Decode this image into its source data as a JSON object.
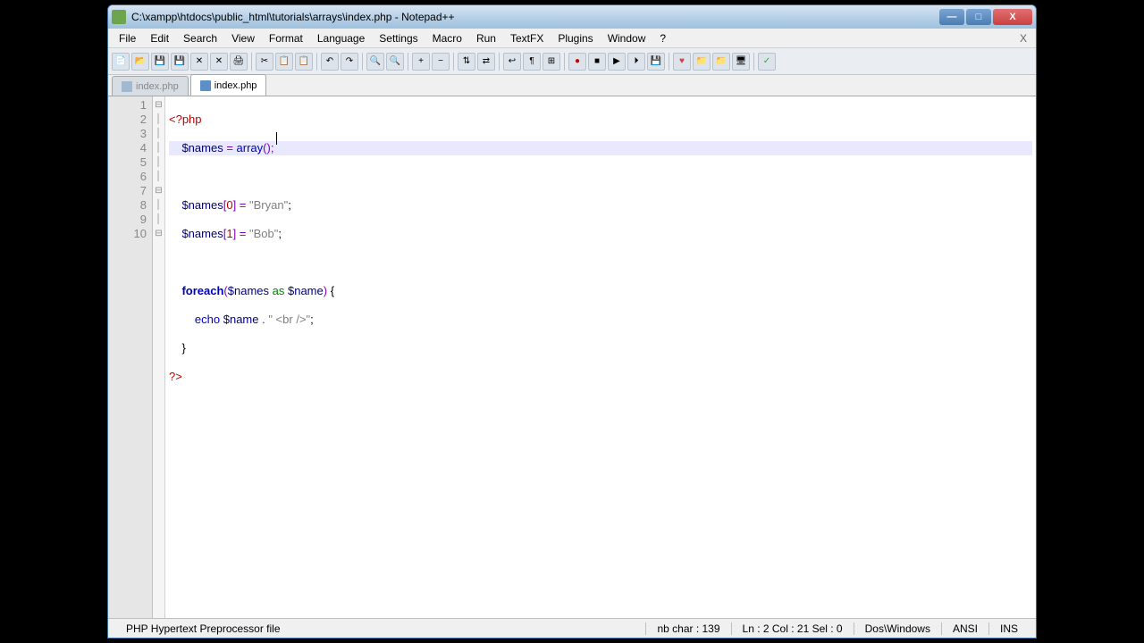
{
  "window": {
    "title": "C:\\xampp\\htdocs\\public_html\\tutorials\\arrays\\index.php - Notepad++"
  },
  "menu": {
    "file": "File",
    "edit": "Edit",
    "search": "Search",
    "view": "View",
    "format": "Format",
    "language": "Language",
    "settings": "Settings",
    "macro": "Macro",
    "run": "Run",
    "textfx": "TextFX",
    "plugins": "Plugins",
    "window": "Window",
    "help": "?",
    "close_x": "X"
  },
  "tabs": {
    "t0": "index.php",
    "t1": "index.php"
  },
  "gutter": {
    "l1": "1",
    "l2": "2",
    "l3": "3",
    "l4": "4",
    "l5": "5",
    "l6": "6",
    "l7": "7",
    "l8": "8",
    "l9": "9",
    "l10": "10"
  },
  "fold": {
    "minus": "⊟",
    "plus": "⊟",
    "bar": "│"
  },
  "code": {
    "l1_open": "<?php",
    "l2_var": "$names",
    "l2_eq": " = ",
    "l2_func": "array",
    "l2_paren": "();",
    "l4_var": "$names",
    "l4_br": "[",
    "l4_idx": "0",
    "l4_br2": "]",
    "l4_eq": " = ",
    "l4_str": "\"Bryan\"",
    "l4_sc": ";",
    "l5_var": "$names",
    "l5_br": "[",
    "l5_idx": "1",
    "l5_br2": "]",
    "l5_eq": " = ",
    "l5_str": "\"Bob\"",
    "l5_sc": ";",
    "l7_kw": "foreach",
    "l7_op": "(",
    "l7_v1": "$names",
    "l7_as": " as ",
    "l7_v2": "$name",
    "l7_cp": ")",
    "l7_ob": " {",
    "l8_echo": "echo",
    "l8_sp": " ",
    "l8_v": "$name",
    "l8_dot": " . ",
    "l8_str": "\" <br />\"",
    "l8_sc": ";",
    "l9_cb": "}",
    "l10_close": "?>"
  },
  "status": {
    "filetype": "PHP Hypertext Preprocessor file",
    "nbchar": "nb char : 139",
    "pos": "Ln : 2    Col : 21    Sel : 0",
    "eol": "Dos\\Windows",
    "enc": "ANSI",
    "ins": "INS"
  }
}
